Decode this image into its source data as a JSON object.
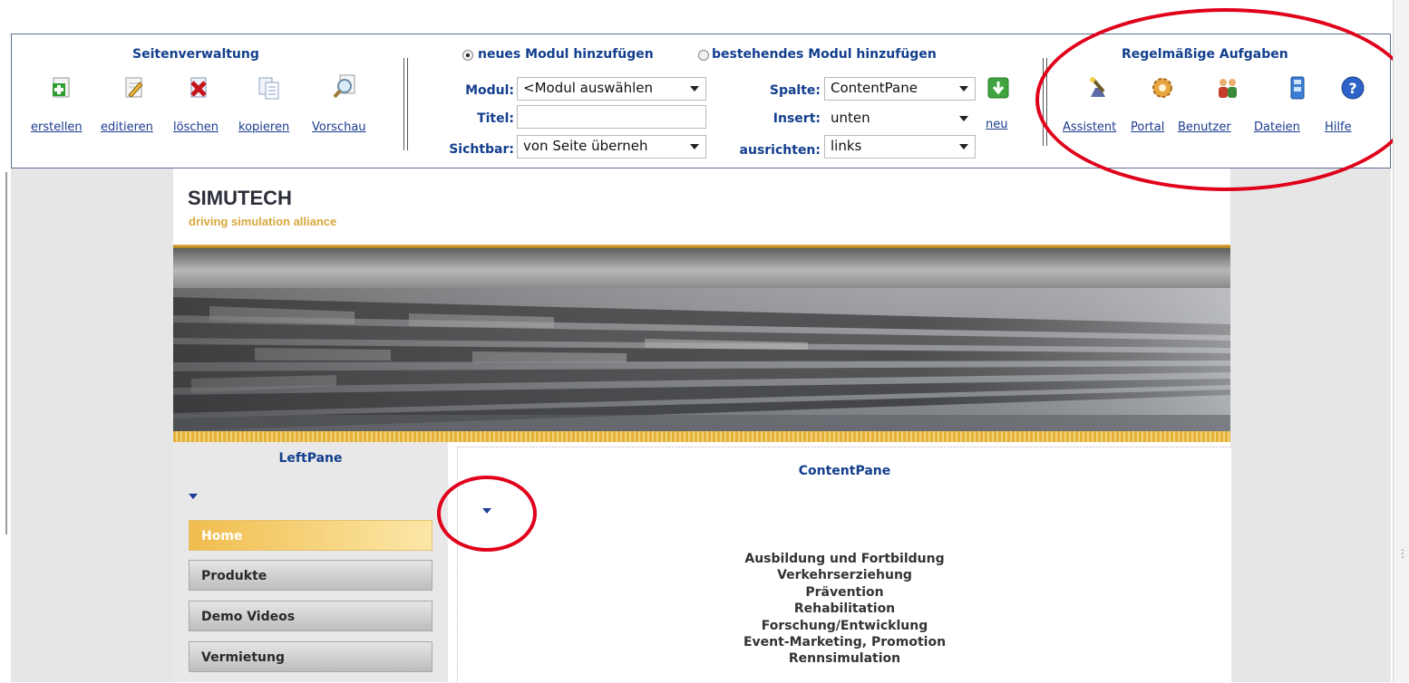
{
  "page_manager": {
    "title": "Seitenverwaltung",
    "actions": [
      {
        "label": "erstellen",
        "icon": "add-page-icon"
      },
      {
        "label": "editieren",
        "icon": "edit-page-icon"
      },
      {
        "label": "löschen",
        "icon": "delete-page-icon"
      },
      {
        "label": "kopieren",
        "icon": "copy-page-icon"
      },
      {
        "label": "Vorschau",
        "icon": "preview-icon"
      }
    ]
  },
  "module_panel": {
    "radio_new": "neues Modul hinzufügen",
    "radio_existing": "bestehendes Modul hinzufügen",
    "selected_mode": "new",
    "modul_label": "Modul:",
    "modul_value": "<Modul auswählen",
    "titel_label": "Titel:",
    "titel_value": "",
    "sichtbar_label": "Sichtbar:",
    "sichtbar_value": "von Seite überneh",
    "spalte_label": "Spalte:",
    "spalte_value": "ContentPane",
    "insert_label": "Insert:",
    "insert_value": "unten",
    "ausrichten_label": "ausrichten:",
    "ausrichten_value": "links",
    "neu_link": "neu"
  },
  "tasks": {
    "title": "Regelmäßige Aufgaben",
    "items": [
      {
        "label": "Assistent",
        "icon": "wizard-icon"
      },
      {
        "label": "Portal",
        "icon": "portal-gear-icon"
      },
      {
        "label": "Benutzer",
        "icon": "users-icon"
      },
      {
        "label": "Dateien",
        "icon": "files-icon"
      },
      {
        "label": "Hilfe",
        "icon": "help-icon"
      }
    ]
  },
  "site": {
    "logo_title": "SIMUTECH",
    "logo_subtitle": "driving simulation alliance",
    "left_pane_title": "LeftPane",
    "content_pane_title": "ContentPane",
    "nav": [
      "Home",
      "Produkte",
      "Demo Videos",
      "Vermietung"
    ],
    "active_nav": "Home",
    "content_lines": [
      "Ausbildung und Fortbildung",
      "Verkehrserziehung",
      "Prävention",
      "Rehabilitation",
      "Forschung/Entwicklung",
      "Event-Marketing, Promotion",
      "Rennsimulation"
    ]
  },
  "colors": {
    "label_blue": "#123f8d",
    "link_blue": "#1a3b8f",
    "annotation_red": "#e0001a",
    "active_nav_gold": "#f0bd4e"
  }
}
